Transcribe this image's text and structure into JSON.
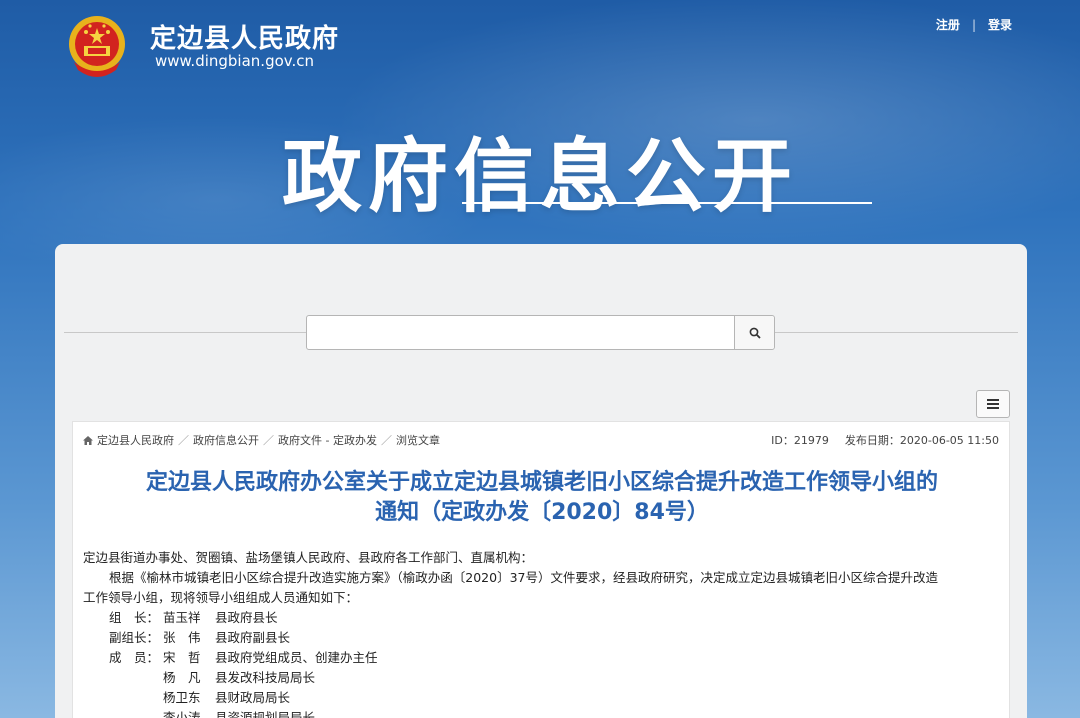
{
  "header": {
    "site_name": "定边县人民政府",
    "site_url": "www.dingbian.gov.cn",
    "register": "注册",
    "login": "登录",
    "separator": "|",
    "big_title": "政府信息公开"
  },
  "search": {
    "placeholder": "",
    "value": ""
  },
  "breadcrumb": {
    "items": [
      "定边县人民政府",
      "政府信息公开",
      "政府文件 - 定政办发",
      "浏览文章"
    ],
    "separator": "／"
  },
  "meta": {
    "id_label": "ID：21979",
    "date_label": "发布日期：2020-06-05 11:50"
  },
  "article": {
    "title_line1": "定边县人民政府办公室关于成立定边县城镇老旧小区综合提升改造工作领导小组的",
    "title_line2": "通知（定政办发〔2020〕84号）",
    "addressee": "定边县街道办事处、贺圈镇、盐场堡镇人民政府、县政府各工作部门、直属机构：",
    "para1": "根据《榆林市城镇老旧小区综合提升改造实施方案》（榆政办函〔2020〕37号）文件要求，经县政府研究，决定成立定边县城镇老旧小区综合提升改造",
    "para1_cont": "工作领导小组，现将领导小组组成人员通知如下：",
    "members": [
      {
        "role": "组　长：",
        "name": "苗玉祥",
        "title": "县政府县长"
      },
      {
        "role": "副组长：",
        "name": "张　伟",
        "title": "县政府副县长"
      },
      {
        "role": "成　员：",
        "name": "宋　哲",
        "title": "县政府党组成员、创建办主任"
      },
      {
        "role": "",
        "name": "杨　凡",
        "title": "县发改科技局局长"
      },
      {
        "role": "",
        "name": "杨卫东",
        "title": "县财政局局长"
      },
      {
        "role": "",
        "name": "李小涛",
        "title": "县资源规划局局长"
      }
    ]
  },
  "colors": {
    "title_blue": "#2a63b0",
    "bg_top": "#1f5ca6",
    "bg_bottom": "#8ab8e2"
  },
  "icons": [
    "national-emblem-icon",
    "search-icon",
    "menu-icon",
    "home-icon"
  ]
}
